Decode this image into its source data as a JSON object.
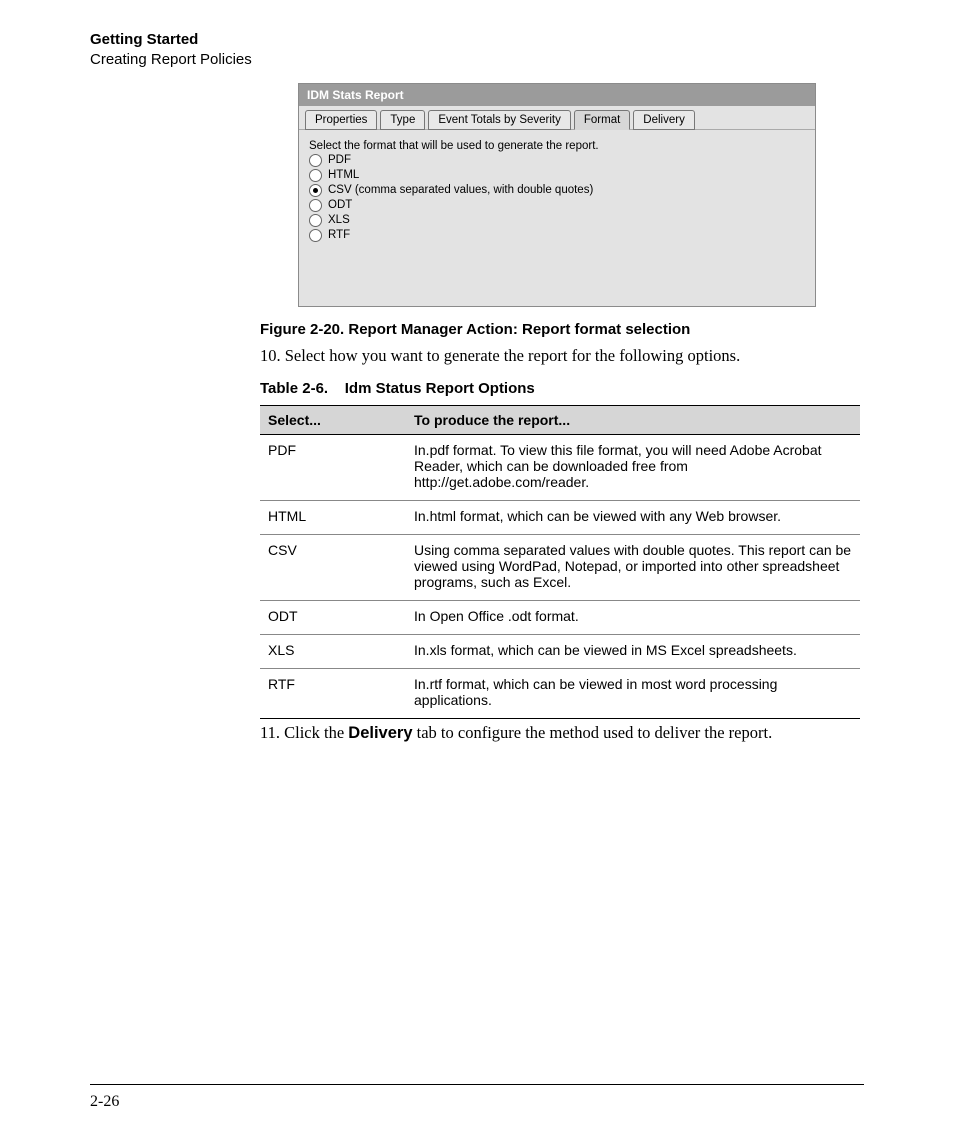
{
  "header": {
    "title": "Getting Started",
    "subtitle": "Creating Report Policies"
  },
  "dialog": {
    "title": "IDM Stats Report",
    "tabs": [
      "Properties",
      "Type",
      "Event Totals by Severity",
      "Format",
      "Delivery"
    ],
    "active_tab_index": 3,
    "instruction": "Select the format that will be used to generate the report.",
    "options": [
      {
        "label": "PDF",
        "selected": false
      },
      {
        "label": "HTML",
        "selected": false
      },
      {
        "label": "CSV (comma separated values, with double quotes)",
        "selected": true
      },
      {
        "label": "ODT",
        "selected": false
      },
      {
        "label": "XLS",
        "selected": false
      },
      {
        "label": "RTF",
        "selected": false
      }
    ]
  },
  "figure_caption": "Figure 2-20. Report Manager Action: Report format selection",
  "step10": "10. Select how you want to generate the report for the following options.",
  "table_caption_prefix": "Table 2-6.",
  "table_caption_title": "Idm Status Report Options",
  "table": {
    "head": [
      "Select...",
      "To produce the report..."
    ],
    "rows": [
      [
        "PDF",
        "In.pdf format. To view this file format, you will need Adobe Acrobat Reader, which can be downloaded free from http://get.adobe.com/reader."
      ],
      [
        "HTML",
        "In.html format, which can be viewed with any Web browser."
      ],
      [
        "CSV",
        "Using comma separated values with double quotes. This report can be viewed using WordPad, Notepad, or imported into other spreadsheet programs, such as Excel."
      ],
      [
        "ODT",
        "In Open Office .odt format."
      ],
      [
        "XLS",
        "In.xls format, which can be viewed in MS Excel spreadsheets."
      ],
      [
        "RTF",
        "In.rtf format, which can be viewed in most word processing applications."
      ]
    ]
  },
  "step11_pre": "11. Click the ",
  "step11_bold": "Delivery",
  "step11_post": " tab to configure the method used to deliver the report.",
  "page_number": "2-26"
}
